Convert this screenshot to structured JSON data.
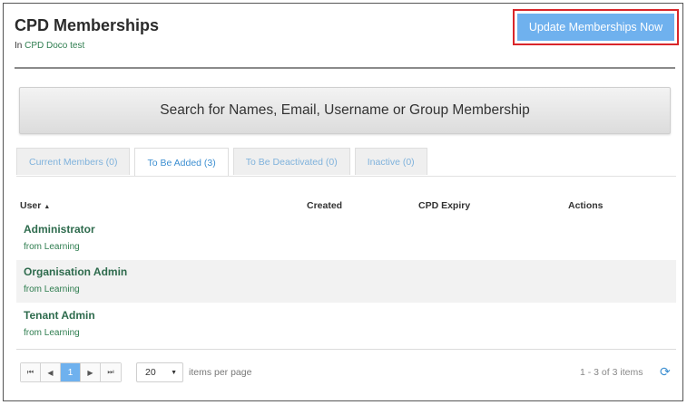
{
  "header": {
    "title": "CPD Memberships",
    "subtitle_prefix": "In",
    "subtitle_link": "CPD Doco test",
    "update_button": "Update Memberships Now"
  },
  "search": {
    "label": "Search for Names, Email, Username or Group Membership"
  },
  "tabs": [
    {
      "label": "Current Members (0)",
      "active": false
    },
    {
      "label": "To Be Added (3)",
      "active": true
    },
    {
      "label": "To Be Deactivated (0)",
      "active": false
    },
    {
      "label": "Inactive (0)",
      "active": false
    }
  ],
  "table": {
    "columns": {
      "user": "User",
      "user_sort": "▲",
      "created": "Created",
      "cpd_expiry": "CPD Expiry",
      "actions": "Actions"
    },
    "rows": [
      {
        "name": "Administrator",
        "source": "from Learning"
      },
      {
        "name": "Organisation Admin",
        "source": "from Learning"
      },
      {
        "name": "Tenant Admin",
        "source": "from Learning"
      }
    ]
  },
  "pager": {
    "first": "⏮",
    "prev": "◀",
    "current_page": "1",
    "next": "▶",
    "last": "⏭",
    "page_size": "20",
    "page_size_caret": "▼",
    "per_page_label": "items per page",
    "range": "1 - 3 of 3 items",
    "refresh_icon": "⟳"
  },
  "colors": {
    "accent": "#6fb1ee",
    "highlight_border": "#d9262a",
    "link_green": "#2e6b4d"
  }
}
